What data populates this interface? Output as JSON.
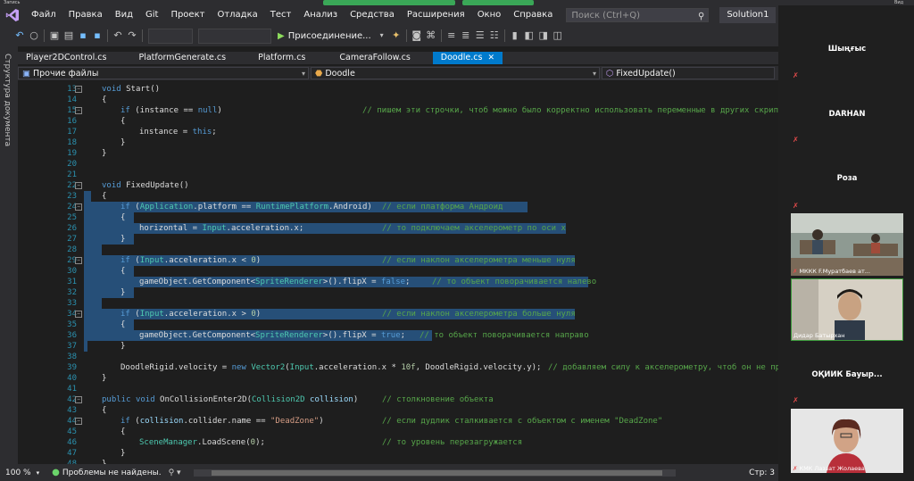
{
  "recording_label": "Запись",
  "window_label": "Вид",
  "menu": [
    "Файл",
    "Правка",
    "Вид",
    "Git",
    "Проект",
    "Отладка",
    "Тест",
    "Анализ",
    "Средства",
    "Расширения",
    "Окно",
    "Справка"
  ],
  "search_placeholder": "Поиск (Ctrl+Q)",
  "solution_name": "Solution1",
  "attach_label": "Присоединение...",
  "sidebar_label": "Структура документа",
  "tabs": [
    "Player2DControl.cs",
    "PlatformGenerate.cs",
    "Platform.cs",
    "CameraFollow.cs",
    "Doodle.cs"
  ],
  "active_tab": "Doodle.cs",
  "nav": {
    "project": "Прочие файлы",
    "class": "Doodle",
    "member": "FixedUpdate()"
  },
  "code_lines": [
    {
      "n": "13",
      "t": "void Start()"
    },
    {
      "n": "14",
      "t": "{"
    },
    {
      "n": "15",
      "t": "if (instance == null)",
      "c": "// пишем эти строчки, чтоб можно было корректно использовать переменные в других скриптах"
    },
    {
      "n": "16",
      "t": "{"
    },
    {
      "n": "17",
      "t": "instance = this;"
    },
    {
      "n": "18",
      "t": "}"
    },
    {
      "n": "19",
      "t": "}"
    },
    {
      "n": "20",
      "t": ""
    },
    {
      "n": "21",
      "t": ""
    },
    {
      "n": "22",
      "t": "void FixedUpdate()"
    },
    {
      "n": "23",
      "t": "{"
    },
    {
      "n": "24",
      "t": "if (Application.platform == RuntimePlatform.Android)",
      "c": "// если платформа Андроид"
    },
    {
      "n": "25",
      "t": "{"
    },
    {
      "n": "26",
      "t": "horizontal = Input.acceleration.x;",
      "c": "// то подключаем акселерометр по оси x"
    },
    {
      "n": "27",
      "t": "}"
    },
    {
      "n": "28",
      "t": ""
    },
    {
      "n": "29",
      "t": "if (Input.acceleration.x < 0)",
      "c": "// если наклон акселерометра меньше нуля"
    },
    {
      "n": "30",
      "t": "{"
    },
    {
      "n": "31",
      "t": "gameObject.GetComponent<SpriteRenderer>().flipX = false;",
      "c": "// то объект поворачивается налево"
    },
    {
      "n": "32",
      "t": "}"
    },
    {
      "n": "33",
      "t": ""
    },
    {
      "n": "34",
      "t": "if (Input.acceleration.x > 0)",
      "c": "// если наклон акселерометра больше нуля"
    },
    {
      "n": "35",
      "t": "{"
    },
    {
      "n": "36",
      "t": "gameObject.GetComponent<SpriteRenderer>().flipX = true;",
      "c": "// то объект поворачивается направо"
    },
    {
      "n": "37",
      "t": "}"
    },
    {
      "n": "38",
      "t": ""
    },
    {
      "n": "39",
      "t": "DoodleRigid.velocity = new Vector2(Input.acceleration.x * 10f, DoodleRigid.velocity.y);",
      "c": "// добавляем силу к акселерометру, чтоб он не пр"
    },
    {
      "n": "40",
      "t": "}"
    },
    {
      "n": "41",
      "t": ""
    },
    {
      "n": "42",
      "t": "public void OnCollisionEnter2D(Collision2D collision)",
      "c": "// столкновение объекта"
    },
    {
      "n": "43",
      "t": "{"
    },
    {
      "n": "44",
      "t": "if (collision.collider.name == \"DeadZone\")",
      "c": "// если дудлик сталкивается с объектом с именем \"DeadZone\""
    },
    {
      "n": "45",
      "t": "{"
    },
    {
      "n": "46",
      "t": "SceneManager.LoadScene(0);",
      "c": "// то уровень перезагружается"
    },
    {
      "n": "47",
      "t": "}"
    },
    {
      "n": "48",
      "t": "}"
    }
  ],
  "status": {
    "zoom": "100 %",
    "problems": "Проблемы не найдены.",
    "line": "Стр: 3"
  },
  "participants": [
    {
      "name": "Шыңғыс"
    },
    {
      "name": "DARHAN"
    },
    {
      "name": "Роза"
    },
    {
      "label": "МККК F.Муратбаев ат..."
    },
    {
      "label": "Дидар Батырхан"
    },
    {
      "name": "ОҚИИК Бауыр..."
    },
    {
      "label": "КМК Лаззат Жолаева"
    }
  ]
}
